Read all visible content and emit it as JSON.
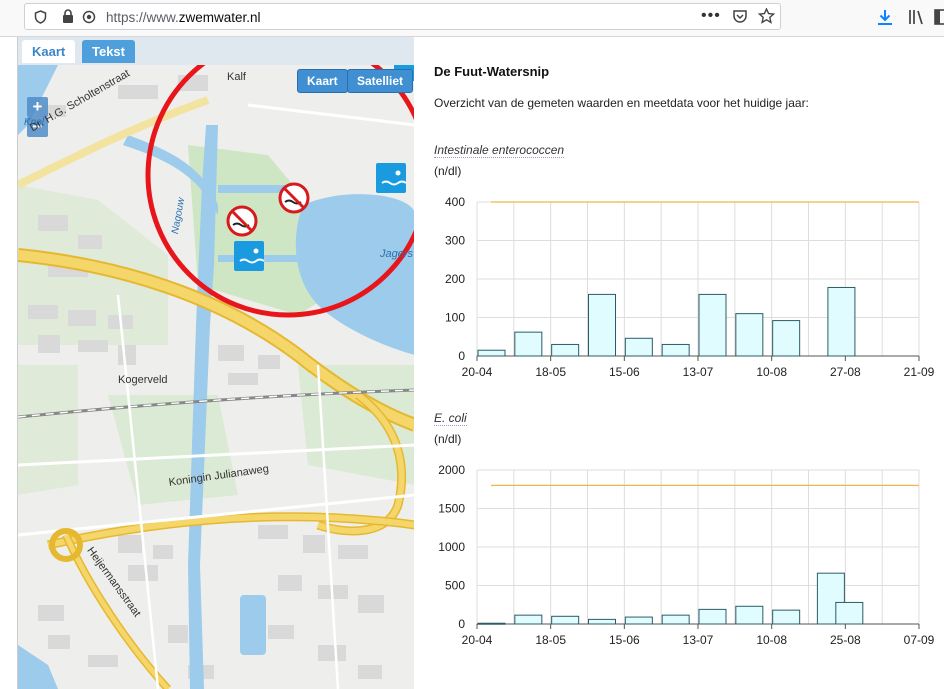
{
  "browser": {
    "url_scheme": "https://www.",
    "url_host": "zwemwater.nl",
    "icons": [
      "shield-icon",
      "lock-icon",
      "tracking-icon",
      "more-icon",
      "pocket-icon",
      "star-icon",
      "download-icon",
      "library-icon",
      "sidebar-icon"
    ]
  },
  "map": {
    "tabs": [
      "Kaart",
      "Tekst"
    ],
    "map_type_buttons": [
      "Kaart",
      "Satelliet"
    ],
    "zoom_in": "+",
    "zoom_out": "−",
    "labels": {
      "street_scholtenstraat": "Dr. H.G. Scholtenstraat",
      "place_kalf": "Kalf",
      "water_nauerna": "Nagouw",
      "water_jager": "Jagers",
      "place_kogerveld": "Kogerveld",
      "street_julianaweg": "Koningin Julianaweg",
      "street_heijermansstraat": "Heijermansstraat",
      "place_knol": "Knol"
    },
    "colors": {
      "radius_ring": "#e8161b",
      "water": "#9ccbec",
      "highway": "#f5c842",
      "swim_marker": "#1a9be0"
    }
  },
  "info": {
    "title": "De Fuut-Watersnip",
    "description": "Overzicht van de gemeten waarden en meetdata voor het huidige jaar:"
  },
  "charts": {
    "enterococcen": {
      "name": "Intestinale enterococcen",
      "unit": "(n/dl)"
    },
    "ecoli": {
      "name": "E. coli",
      "unit": "(n/dl)"
    }
  },
  "chart_data": [
    {
      "type": "bar",
      "title": "Intestinale enterococcen",
      "ylabel": "(n/dl)",
      "ylim": [
        0,
        400
      ],
      "yticks": [
        0,
        100,
        200,
        300,
        400
      ],
      "xtick_labels": [
        "20-04",
        "18-05",
        "15-06",
        "13-07",
        "10-08",
        "27-08",
        "21-09"
      ],
      "x_is_date": true,
      "x_range": [
        "2020-04-20",
        "2020-09-21"
      ],
      "threshold": 400,
      "values": [
        {
          "date": "2020-04-20",
          "value": 15
        },
        {
          "date": "2020-05-04",
          "value": 62
        },
        {
          "date": "2020-05-18",
          "value": 30
        },
        {
          "date": "2020-06-01",
          "value": 160
        },
        {
          "date": "2020-06-15",
          "value": 46
        },
        {
          "date": "2020-06-29",
          "value": 30
        },
        {
          "date": "2020-07-13",
          "value": 160
        },
        {
          "date": "2020-07-27",
          "value": 110
        },
        {
          "date": "2020-08-10",
          "value": 92
        },
        {
          "date": "2020-08-31",
          "value": 178
        }
      ],
      "grid": true,
      "colors": {
        "bar_fill": "#e0fcfe",
        "bar_stroke": "#2c5b66",
        "threshold": "#f0b44c",
        "grid": "#dddddd"
      }
    },
    {
      "type": "bar",
      "title": "E. coli",
      "ylabel": "(n/dl)",
      "ylim": [
        0,
        2000
      ],
      "yticks": [
        0,
        500,
        1000,
        1500,
        2000
      ],
      "xtick_labels": [
        "20-04",
        "18-05",
        "15-06",
        "13-07",
        "10-08",
        "25-08",
        "07-09"
      ],
      "x_is_date": true,
      "threshold": 1800,
      "values": [
        {
          "date": "2020-04-20",
          "value": 10
        },
        {
          "date": "2020-05-04",
          "value": 115
        },
        {
          "date": "2020-05-18",
          "value": 100
        },
        {
          "date": "2020-06-01",
          "value": 60
        },
        {
          "date": "2020-06-15",
          "value": 90
        },
        {
          "date": "2020-06-29",
          "value": 115
        },
        {
          "date": "2020-07-13",
          "value": 190
        },
        {
          "date": "2020-07-27",
          "value": 230
        },
        {
          "date": "2020-08-10",
          "value": 180
        },
        {
          "date": "2020-08-27",
          "value": 660
        },
        {
          "date": "2020-09-03",
          "value": 280
        }
      ],
      "grid": true,
      "colors": {
        "bar_fill": "#e0fcfe",
        "bar_stroke": "#2c5b66",
        "threshold": "#f0b44c",
        "grid": "#dddddd"
      }
    }
  ]
}
